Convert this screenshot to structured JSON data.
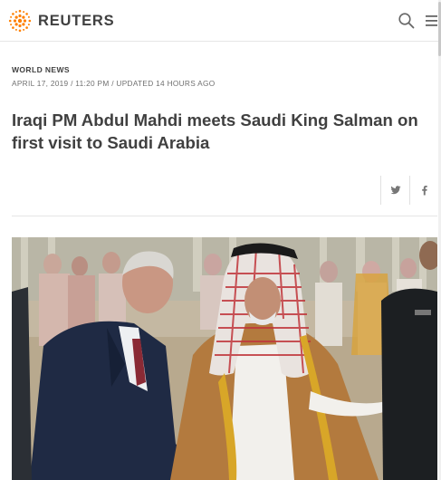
{
  "header": {
    "brand": "REUTERS",
    "logo_icon": "reuters-dot-logo-icon",
    "brand_color": "#FF8000",
    "search_icon": "search-icon",
    "menu_icon": "menu-icon"
  },
  "article": {
    "section": "WORLD NEWS",
    "dateline": "APRIL 17, 2019 / 11:20 PM / UPDATED 14 HOURS AGO",
    "headline": "Iraqi PM Abdul Mahdi meets Saudi King Salman on first visit to Saudi Arabia"
  },
  "share": {
    "twitter_icon": "twitter-icon",
    "facebook_icon": "facebook-icon"
  },
  "photo": {
    "subject": "lead-photo"
  }
}
